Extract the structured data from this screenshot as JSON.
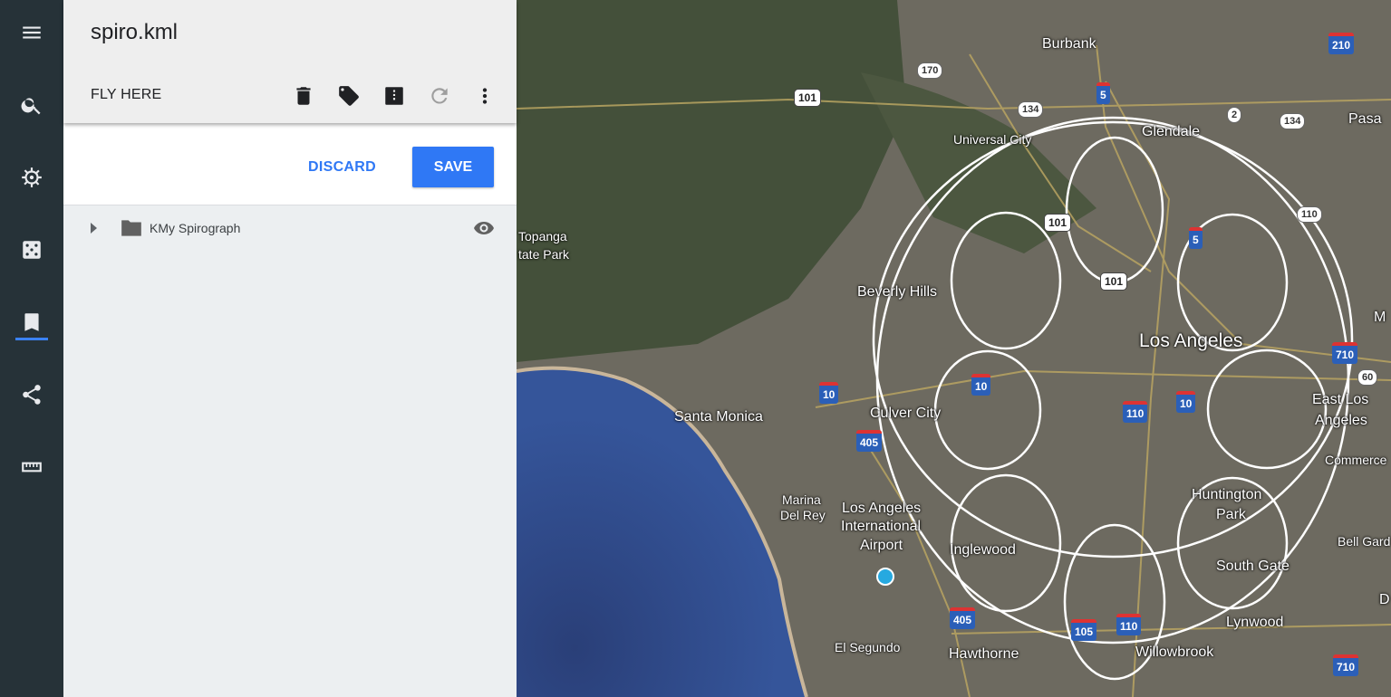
{
  "rail": {
    "items": [
      {
        "name": "menu-icon"
      },
      {
        "name": "search-icon"
      },
      {
        "name": "voyager-wheel-icon"
      },
      {
        "name": "dice-icon"
      },
      {
        "name": "bookmark-icon",
        "active": true
      },
      {
        "name": "share-icon"
      },
      {
        "name": "ruler-icon"
      }
    ],
    "accent_color": "#3b82f6"
  },
  "panel": {
    "file_title": "spiro.kml",
    "fly_here_label": "FLY HERE",
    "toolbar_icons": [
      "delete-icon",
      "label-icon",
      "description-icon",
      "refresh-icon",
      "more-vert-icon"
    ]
  },
  "actions": {
    "discard_label": "DISCARD",
    "save_label": "SAVE",
    "accent_color": "#2f78f5"
  },
  "tree": {
    "items": [
      {
        "label": "KMy Spirograph",
        "type": "folder",
        "visible": true
      }
    ]
  },
  "map": {
    "labels": {
      "burbank": "Burbank",
      "glendale": "Glendale",
      "universal_city": "Universal City",
      "pasadena": "Pasa",
      "topanga": "Topanga",
      "state_park": "tate Park",
      "beverly_hills": "Beverly Hills",
      "los_angeles": "Los Angeles",
      "santa_monica": "Santa Monica",
      "culver_city": "Culver City",
      "east_los_angeles_1": "East Los",
      "east_los_angeles_2": "Angeles",
      "commerce": "Commerce",
      "marina_1": "Marina",
      "marina_2": "Del Rey",
      "lax_1": "Los Angeles",
      "lax_2": "International",
      "lax_3": "Airport",
      "huntington_park_1": "Huntington",
      "huntington_park_2": "Park",
      "inglewood": "Inglewood",
      "south_gate": "South Gate",
      "bell_gardens": "Bell Gard",
      "lynwood": "Lynwood",
      "el_segundo": "El Segundo",
      "hawthorne": "Hawthorne",
      "willowbrook": "Willowbrook",
      "m_edge": "M",
      "d_edge": "D"
    },
    "shields": {
      "i210": "210",
      "i5a": "5",
      "i5b": "5",
      "us101a": "101",
      "us101b": "101",
      "us101c": "101",
      "s170": "170",
      "s134a": "134",
      "s134b": "134",
      "s2": "2",
      "s110": "110",
      "i10a": "10",
      "i10b": "10",
      "i10c": "10",
      "i405a": "405",
      "i405b": "405",
      "i110a": "110",
      "i110b": "110",
      "i105": "105",
      "i710a": "710",
      "i710b": "710",
      "s60": "60"
    }
  }
}
